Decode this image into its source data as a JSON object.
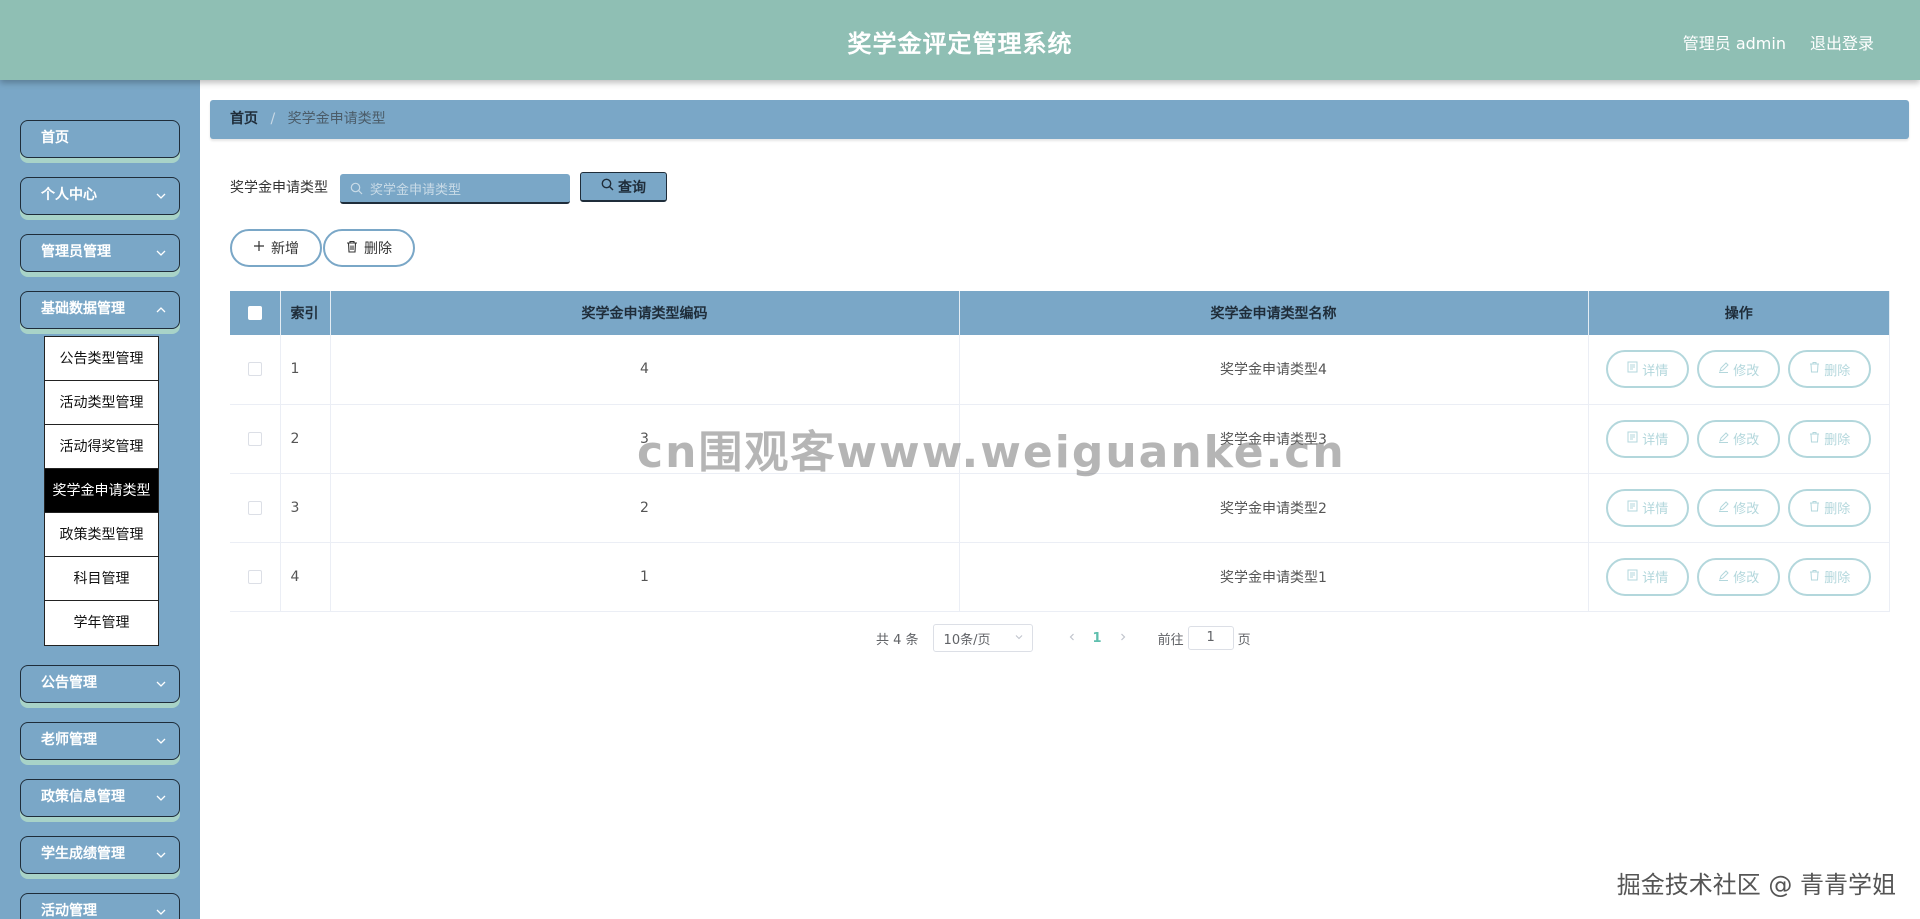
{
  "header": {
    "title": "奖学金评定管理系统",
    "user": "管理员 admin",
    "logout": "退出登录"
  },
  "sidebar": {
    "items": [
      {
        "label": "首页"
      },
      {
        "label": "个人中心"
      },
      {
        "label": "管理员管理"
      },
      {
        "label": "基础数据管理"
      },
      {
        "label": "公告管理"
      },
      {
        "label": "老师管理"
      },
      {
        "label": "政策信息管理"
      },
      {
        "label": "学生成绩管理"
      },
      {
        "label": "活动管理"
      }
    ],
    "submenu": [
      {
        "label": "公告类型管理"
      },
      {
        "label": "活动类型管理"
      },
      {
        "label": "活动得奖管理"
      },
      {
        "label": "奖学金申请类型"
      },
      {
        "label": "政策类型管理"
      },
      {
        "label": "科目管理"
      },
      {
        "label": "学年管理"
      }
    ]
  },
  "breadcrumb": {
    "home": "首页",
    "sep": "/",
    "current": "奖学金申请类型"
  },
  "search": {
    "label": "奖学金申请类型",
    "placeholder": "奖学金申请类型",
    "button": "查询"
  },
  "actions": {
    "add": "新增",
    "delete": "删除"
  },
  "table": {
    "headers": [
      "索引",
      "奖学金申请类型编码",
      "奖学金申请类型名称",
      "操作"
    ],
    "rows": [
      {
        "index": "1",
        "code": "4",
        "name": "奖学金申请类型4"
      },
      {
        "index": "2",
        "code": "3",
        "name": "奖学金申请类型3"
      },
      {
        "index": "3",
        "code": "2",
        "name": "奖学金申请类型2"
      },
      {
        "index": "4",
        "code": "1",
        "name": "奖学金申请类型1"
      }
    ],
    "ops": {
      "detail": "详情",
      "edit": "修改",
      "delete": "删除"
    }
  },
  "pagination": {
    "total": "共 4 条",
    "page_size": "10条/页",
    "current_page": "1",
    "goto_label": "前往",
    "goto_value": "1",
    "page_suffix": "页"
  },
  "watermarks": {
    "center": "cn围观客www.weiguanke.cn",
    "corner": "掘金技术社区 @ 青青学姐"
  },
  "colors": {
    "header": "#8fbfb4",
    "sidebar": "#7aa7c7",
    "accent_pill": "#b3d7dc",
    "active_page": "#5fbfae"
  }
}
